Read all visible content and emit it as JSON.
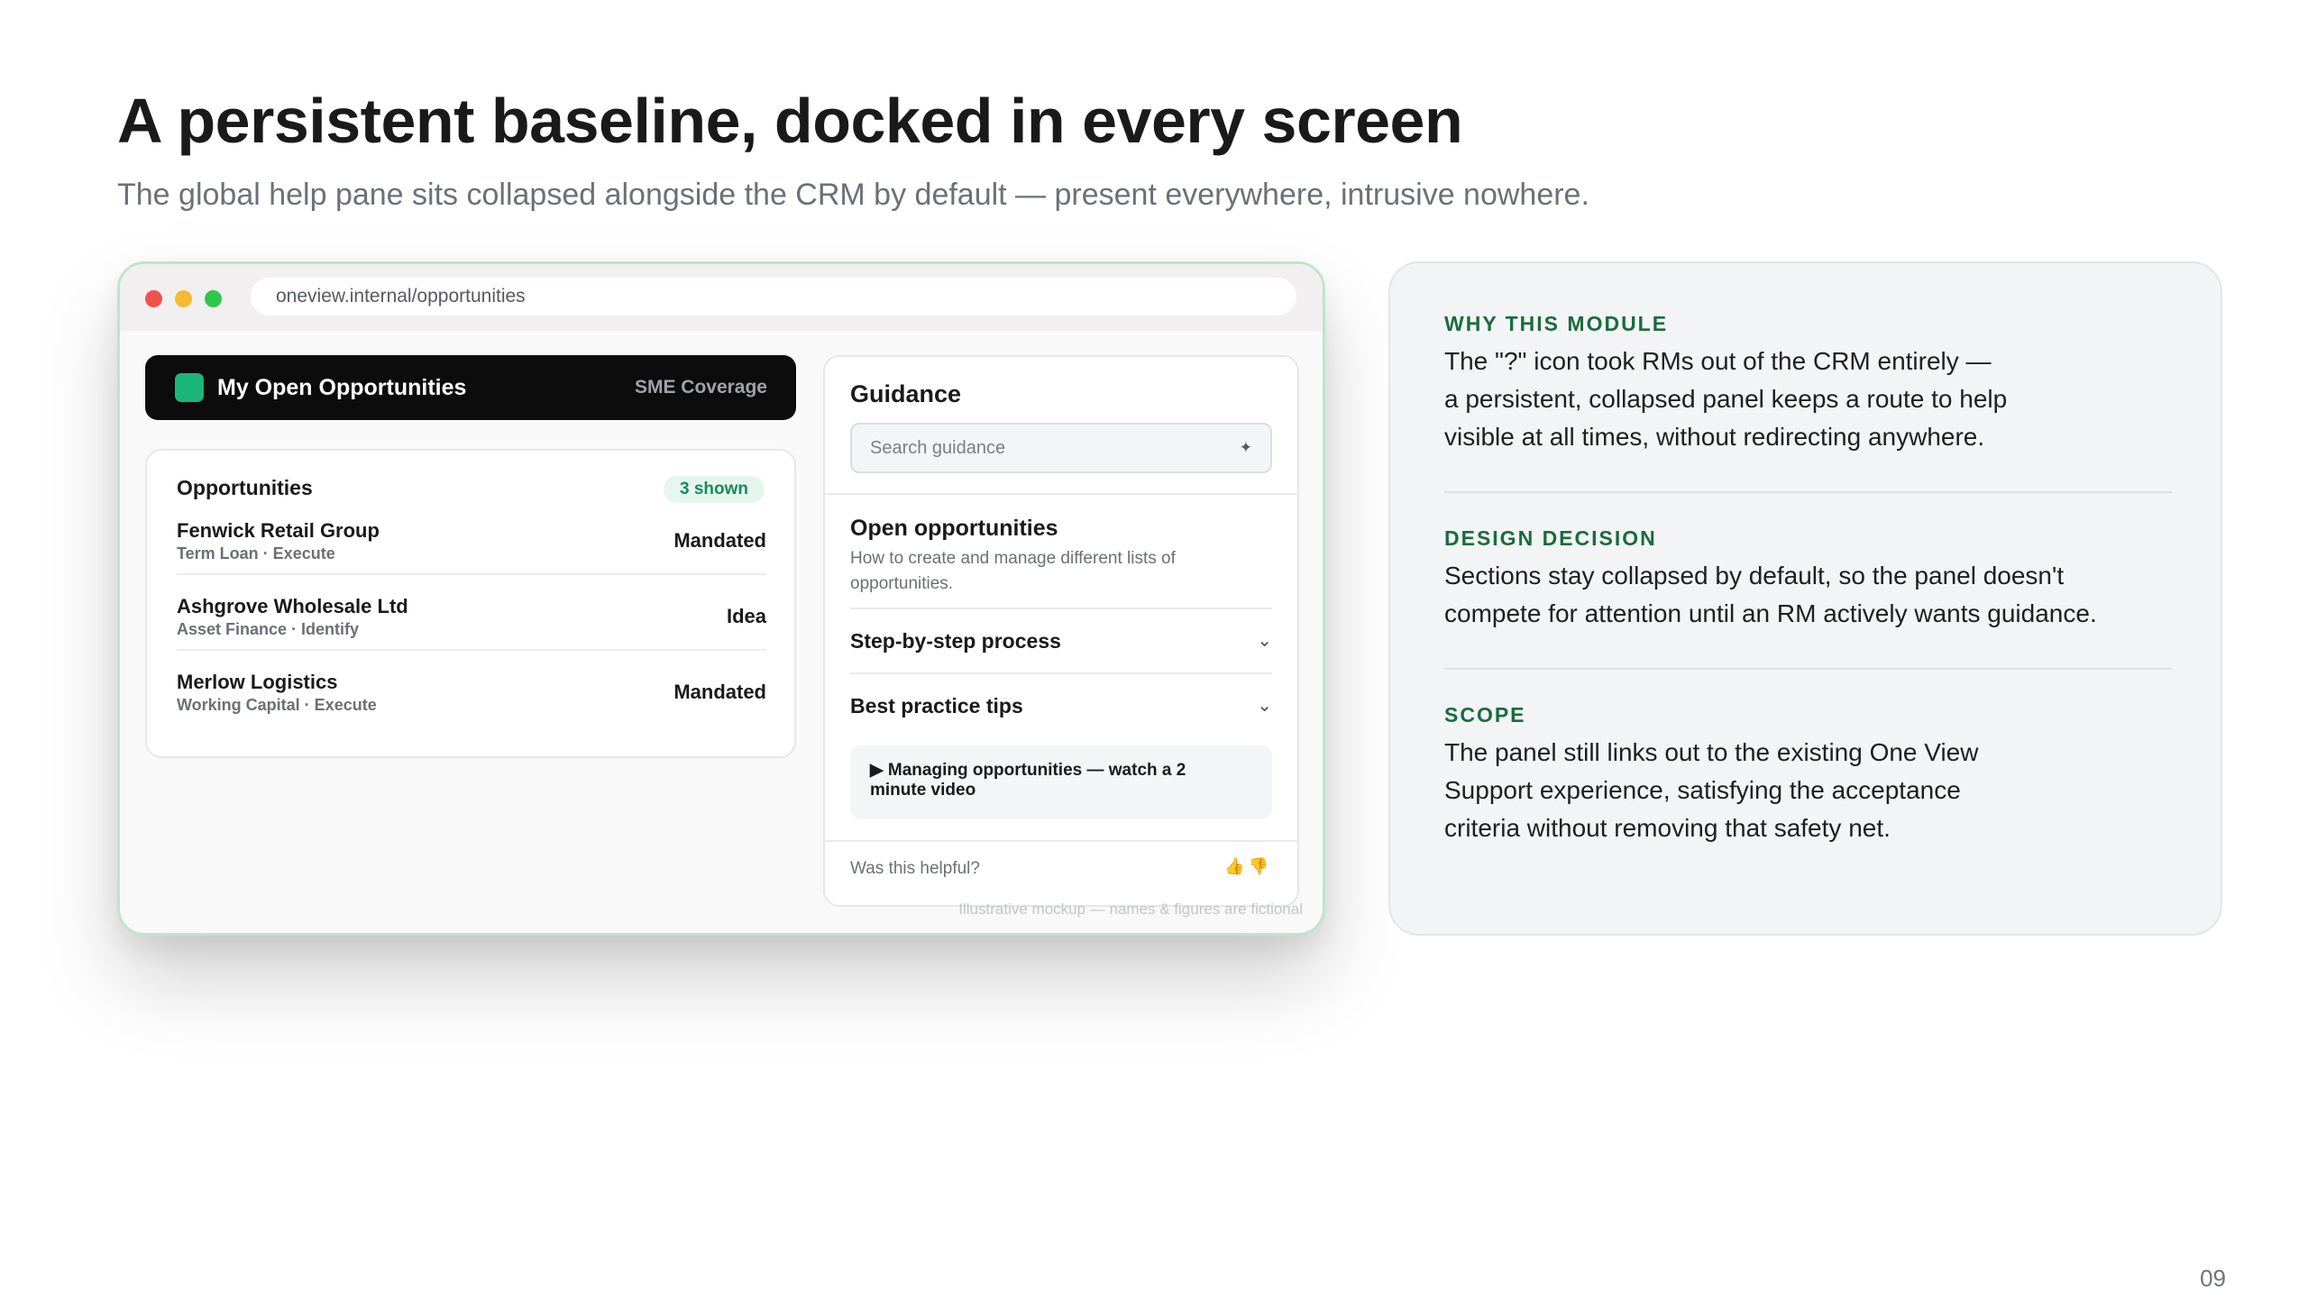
{
  "slide": {
    "title": "A persistent baseline, docked in every screen",
    "subtitle": "The global help pane sits collapsed alongside the CRM by default — present everywhere, intrusive nowhere.",
    "page_number": "09"
  },
  "browser": {
    "url": "oneview.internal/opportunities",
    "caption": "Illustrative mockup — names & figures are fictional"
  },
  "crm": {
    "header_title": "My Open Opportunities",
    "segment": "SME Coverage",
    "card_title": "Opportunities",
    "count_badge": "3 shown",
    "rows": [
      {
        "name": "Fenwick Retail Group",
        "meta": "Term Loan · Execute",
        "stage": "Mandated"
      },
      {
        "name": "Ashgrove Wholesale Ltd",
        "meta": "Asset Finance · Identify",
        "stage": "Idea"
      },
      {
        "name": "Merlow Logistics",
        "meta": "Working Capital · Execute",
        "stage": "Mandated"
      }
    ]
  },
  "guidance": {
    "title": "Guidance",
    "search_placeholder": "Search guidance",
    "sparkle_glyph": "✦",
    "section_title": "Open opportunities",
    "section_desc": "How to create and manage different lists of opportunities.",
    "accordions": [
      {
        "label": "Step-by-step process",
        "chevron": "⌄"
      },
      {
        "label": "Best practice tips",
        "chevron": "⌄"
      }
    ],
    "video_label": "▶ Managing opportunities — watch a 2 minute video",
    "helpful_prompt": "Was this helpful?",
    "thumbs_up": "👍",
    "thumbs_down": "👎"
  },
  "info": {
    "blocks": [
      {
        "heading": "WHY THIS MODULE",
        "lines": [
          "The \"?\" icon took RMs out of the CRM entirely —",
          "a persistent, collapsed panel keeps a route to help",
          "visible at all times, without redirecting anywhere."
        ]
      },
      {
        "heading": "DESIGN DECISION",
        "lines": [
          "Sections stay collapsed by default, so the panel doesn't",
          "compete for attention until an RM actively wants guidance."
        ]
      },
      {
        "heading": "SCOPE",
        "lines": [
          "The panel still links out to the existing One View",
          "Support experience, satisfying the acceptance",
          "criteria without removing that safety net."
        ]
      }
    ]
  },
  "colors": {
    "accent_green": "#1b6b3d",
    "badge_green": "#178b5c",
    "logo_green": "#1bb57a"
  }
}
